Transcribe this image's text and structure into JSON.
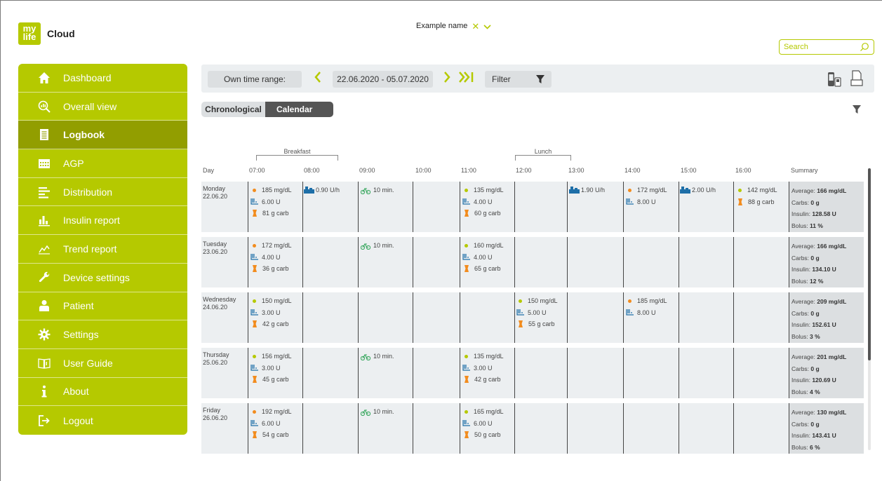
{
  "brand": {
    "logo_text": "my life",
    "app_name": "Cloud",
    "accent": "#b5c900"
  },
  "patient": {
    "name": "Example name"
  },
  "search": {
    "placeholder": "Search"
  },
  "sidebar": {
    "items": [
      {
        "label": "Dashboard",
        "icon": "home-icon"
      },
      {
        "label": "Overall view",
        "icon": "overview-icon"
      },
      {
        "label": "Logbook",
        "icon": "logbook-icon",
        "active": true
      },
      {
        "label": "AGP",
        "icon": "agp-icon"
      },
      {
        "label": "Distribution",
        "icon": "distribution-icon"
      },
      {
        "label": "Insulin report",
        "icon": "insulin-report-icon"
      },
      {
        "label": "Trend report",
        "icon": "trend-icon"
      },
      {
        "label": "Device settings",
        "icon": "wrench-icon"
      },
      {
        "label": "Patient",
        "icon": "patient-icon"
      },
      {
        "label": "Settings",
        "icon": "gear-icon"
      },
      {
        "label": "User Guide",
        "icon": "book-icon"
      },
      {
        "label": "About",
        "icon": "info-icon"
      },
      {
        "label": "Logout",
        "icon": "logout-icon"
      }
    ]
  },
  "toolbar": {
    "own_range": "Own time range:",
    "date_range": "22.06.2020 - 05.07.2020",
    "filter": "Filter"
  },
  "view": {
    "chronological": "Chronological",
    "calendar": "Calendar"
  },
  "calendar": {
    "meals": {
      "breakfast": "Breakfast",
      "lunch": "Lunch"
    },
    "headers": {
      "day": "Day",
      "h07": "07:00",
      "h08": "08:00",
      "h09": "09:00",
      "h10": "10:00",
      "h11": "11:00",
      "h12": "12:00",
      "h13": "13:00",
      "h14": "14:00",
      "h15": "15:00",
      "h16": "16:00",
      "summary": "Summary"
    },
    "rows": [
      {
        "weekday": "Monday",
        "date": "22.06.20",
        "c07": {
          "bg": "185 mg/dL",
          "insulin": "6.00 U",
          "carb": "81 g carb"
        },
        "c08": {
          "basal": "0.90 U/h"
        },
        "c09": {
          "activity": "10 min."
        },
        "c11": {
          "bg": "135 mg/dL",
          "insulin": "4.00 U",
          "carb": "60 g carb"
        },
        "c13": {
          "basal": "1.90 U/h"
        },
        "c14": {
          "bg": "172 mg/dL",
          "insulin": "8.00 U"
        },
        "c15": {
          "basal": "2.00 U/h"
        },
        "c16": {
          "bg": "142 mg/dL",
          "carb": "88 g carb"
        },
        "summary": {
          "average": "166 mg/dL",
          "carbs": "0 g",
          "insulin": "128.58 U",
          "bolus": "11 %"
        }
      },
      {
        "weekday": "Tuesday",
        "date": "23.06.20",
        "c07": {
          "bg": "172 mg/dL",
          "insulin": "4.00 U",
          "carb": "36 g carb"
        },
        "c09": {
          "activity": "10 min."
        },
        "c11": {
          "bg": "160 mg/dL",
          "insulin": "4.00 U",
          "carb": "65 g carb"
        },
        "summary": {
          "average": "166 mg/dL",
          "carbs": "0 g",
          "insulin": "134.10 U",
          "bolus": "12 %"
        }
      },
      {
        "weekday": "Wednesday",
        "date": "24.06.20",
        "c07": {
          "bg": "150 mg/dL",
          "insulin": "3.00 U",
          "carb": "42 g carb"
        },
        "c12": {
          "bg": "150 mg/dL",
          "insulin": "5.00 U",
          "carb": "55 g carb"
        },
        "c14": {
          "bg": "185 mg/dL",
          "insulin": "8.00 U"
        },
        "summary": {
          "average": "209 mg/dL",
          "carbs": "0 g",
          "insulin": "152.61 U",
          "bolus": "3 %"
        }
      },
      {
        "weekday": "Thursday",
        "date": "25.06.20",
        "c07": {
          "bg": "156 mg/dL",
          "insulin": "3.00 U",
          "carb": "45 g carb"
        },
        "c09": {
          "activity": "10 min."
        },
        "c11": {
          "bg": "135 mg/dL",
          "insulin": "3.00 U",
          "carb": "42 g carb"
        },
        "summary": {
          "average": "201 mg/dL",
          "carbs": "0 g",
          "insulin": "120.69 U",
          "bolus": "4 %"
        }
      },
      {
        "weekday": "Friday",
        "date": "26.06.20",
        "c07": {
          "bg": "192 mg/dL",
          "insulin": "6.00 U",
          "carb": "54 g carb"
        },
        "c09": {
          "activity": "10 min."
        },
        "c11": {
          "bg": "165 mg/dL",
          "insulin": "6.00 U",
          "carb": "50 g carb"
        },
        "summary": {
          "average": "130 mg/dL",
          "carbs": "0 g",
          "insulin": "143.41 U",
          "bolus": "6 %"
        }
      }
    ],
    "summary_labels": {
      "average": "Average:",
      "carbs": "Carbs:",
      "insulin": "Insulin:",
      "bolus": "Bolus:"
    }
  }
}
